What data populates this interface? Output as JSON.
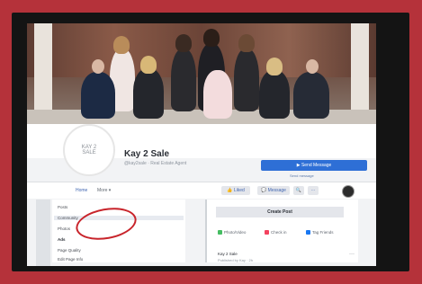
{
  "page": {
    "name": "Kay 2 Sale",
    "handle": "@kay2sale · Real Estate Agent",
    "logo_text_line1": "KAY 2",
    "logo_text_line2": "SALE"
  },
  "actions": {
    "primary": "▶ Send Message",
    "secondary_link": "Send message"
  },
  "nav": {
    "tabs": [
      "Home",
      "More ▾"
    ],
    "like_button": "👍 Liked",
    "message_button": "💬 Message",
    "search_button": "🔍",
    "more_button": "···"
  },
  "left_menu": {
    "items": [
      "Posts",
      "Community",
      "Photos",
      "Ads",
      "Page Quality",
      "Edit Page Info"
    ]
  },
  "composer": {
    "title": "Create Post",
    "options": [
      "Photo/Video",
      "Check in",
      "Tag Friends"
    ]
  },
  "post": {
    "author": "Kay 2 Sale",
    "time": "Published by Kay · 2h"
  },
  "colors": {
    "background": "#b5323a",
    "accent_blue": "#2e6fd6",
    "highlight_red": "#c8242b"
  }
}
